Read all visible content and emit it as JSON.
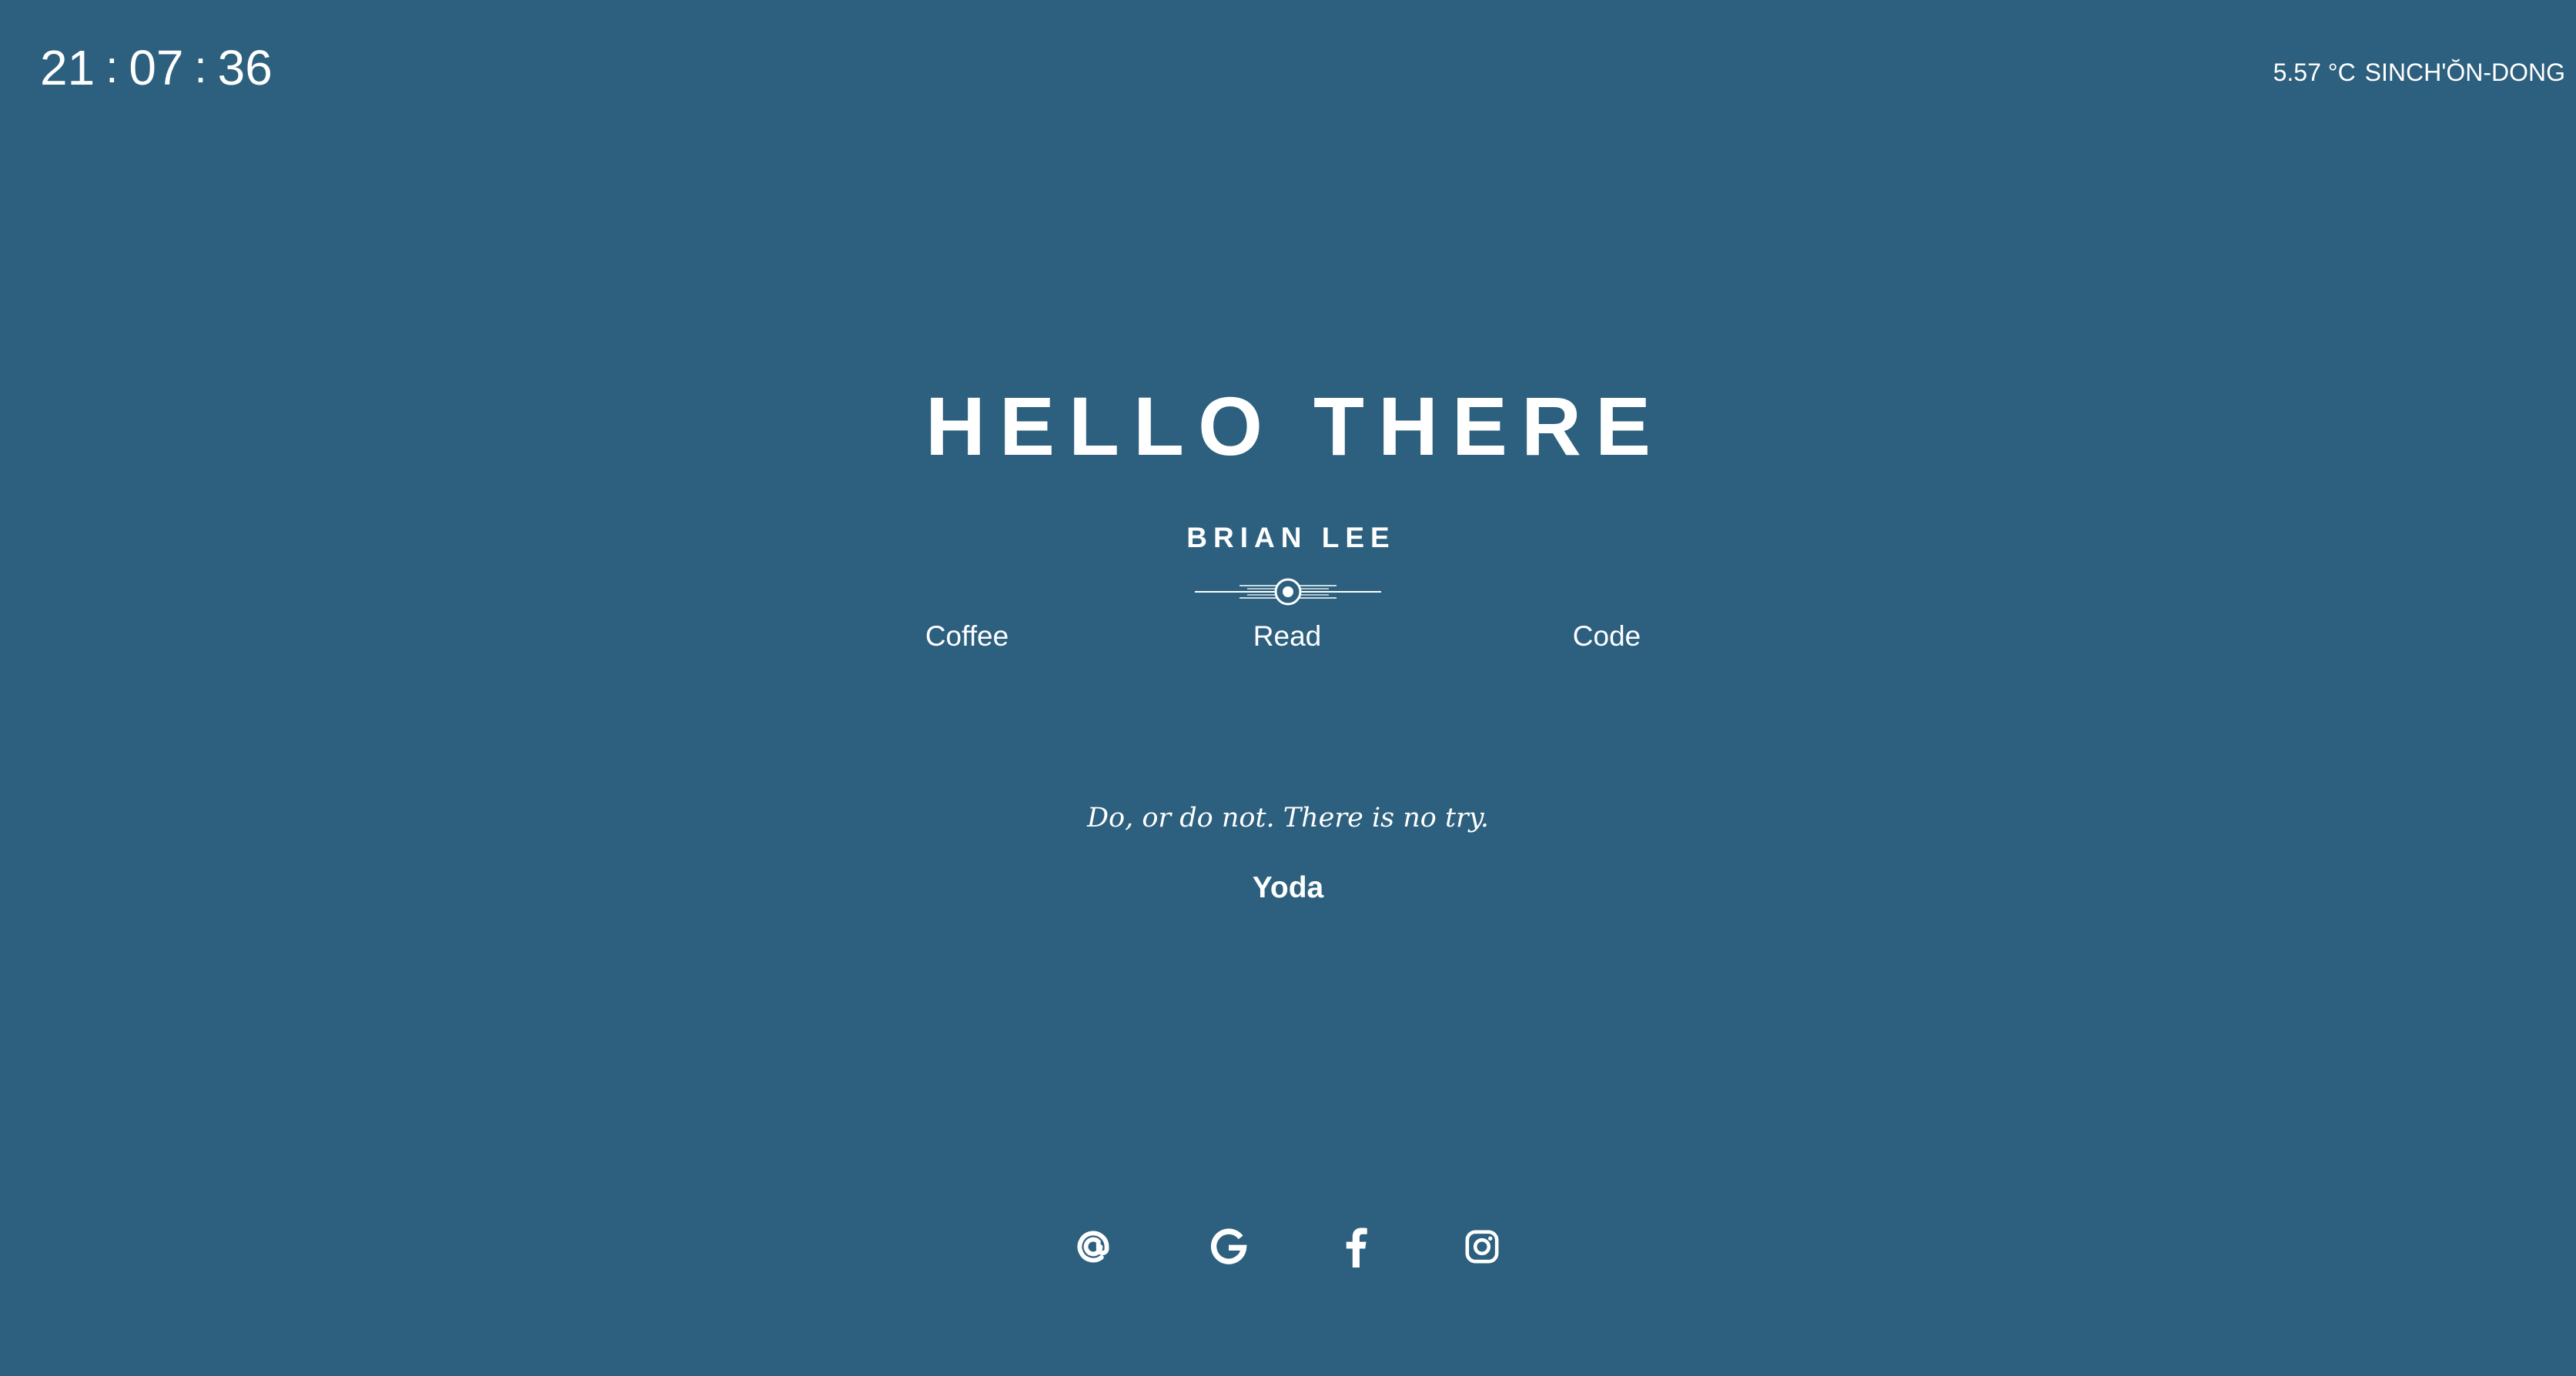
{
  "clock": {
    "hours": "21",
    "minutes": "07",
    "seconds": "36",
    "separator": ":"
  },
  "weather": {
    "temperature": "5.57",
    "unit": "°C",
    "location": "SINCH'ŎN-DONG"
  },
  "greeting": "HELLO THERE",
  "name": "BRIAN LEE",
  "links": [
    {
      "label": "Coffee"
    },
    {
      "label": "Read"
    },
    {
      "label": "Code"
    }
  ],
  "quote": {
    "text": "Do, or do not. There is no try.",
    "author": "Yoda"
  },
  "social": [
    {
      "icon": "at-sign-icon"
    },
    {
      "icon": "google-icon"
    },
    {
      "icon": "facebook-icon"
    },
    {
      "icon": "instagram-icon"
    }
  ]
}
